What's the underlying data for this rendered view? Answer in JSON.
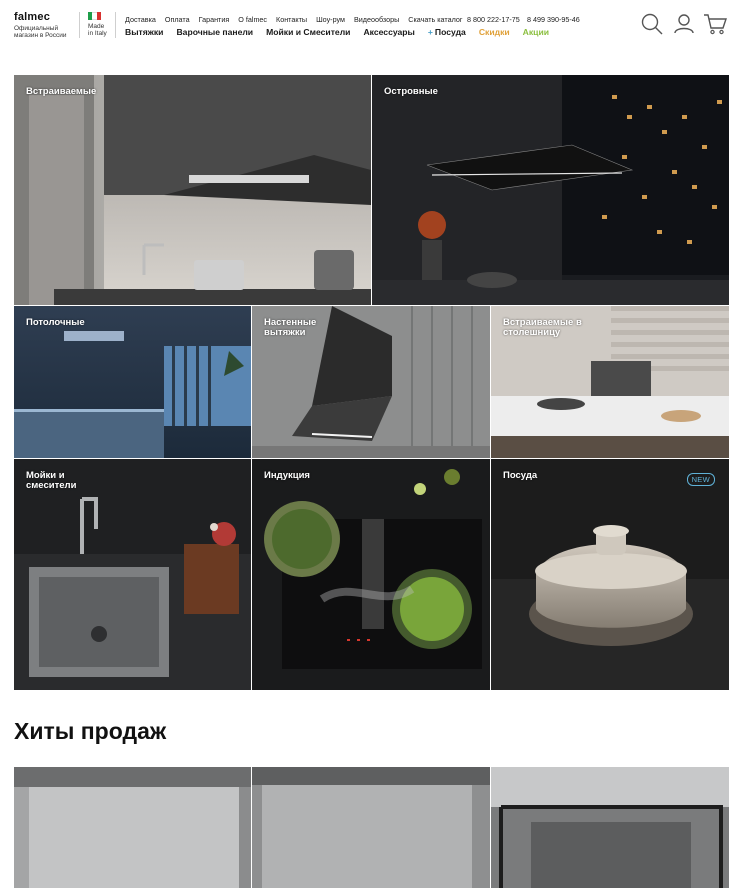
{
  "header": {
    "logo": {
      "name": "falmec",
      "subtitle": "Официальный магазин в России"
    },
    "made_in": "Made in Italy",
    "top_links": [
      "Доставка",
      "Оплата",
      "Гарантия",
      "О falmec",
      "Контакты",
      "Шоу-рум",
      "Видеообзоры",
      "Скачать каталог"
    ],
    "phones": [
      "8 800 222-17-75",
      "8 499 390-95-46"
    ],
    "categories": [
      {
        "label": "Вытяжки"
      },
      {
        "label": "Варочные панели"
      },
      {
        "label": "Мойки и Смесители"
      },
      {
        "label": "Аксессуары"
      },
      {
        "label": "Посуда",
        "prefix": "+"
      },
      {
        "label": "Скидки",
        "color": "#e0a13a"
      },
      {
        "label": "Акции",
        "color": "#8bbf3f"
      }
    ],
    "icons": [
      "search-icon",
      "user-icon",
      "cart-icon"
    ]
  },
  "tiles": [
    {
      "label": "Встраиваемые"
    },
    {
      "label": "Островные"
    },
    {
      "label": "Потолочные"
    },
    {
      "label": "Настенные вытяжки"
    },
    {
      "label": "Встраиваемые в столешницу"
    },
    {
      "label": "Мойки и смесители"
    },
    {
      "label": "Индукция"
    },
    {
      "label": "Посуда",
      "badge": "NEW"
    }
  ],
  "bestsellers": {
    "title": "Хиты продаж"
  },
  "colors": {
    "accent_blue": "#4aa0c8",
    "discount": "#e0a13a",
    "promo": "#8bbf3f",
    "new_badge": "#5fb2d8"
  }
}
